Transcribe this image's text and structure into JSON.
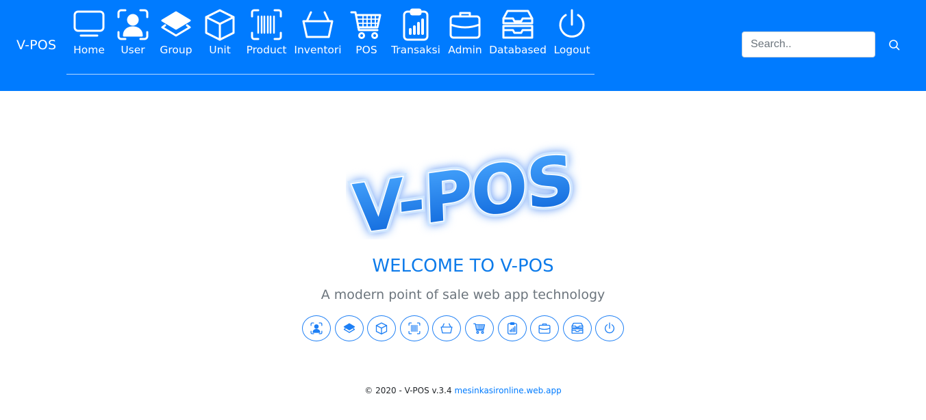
{
  "brand": "V-POS",
  "nav": [
    {
      "label": "Home",
      "icon": "monitor-icon"
    },
    {
      "label": "User",
      "icon": "user-icon"
    },
    {
      "label": "Group",
      "icon": "layers-icon"
    },
    {
      "label": "Unit",
      "icon": "box-icon"
    },
    {
      "label": "Product",
      "icon": "barcode-icon"
    },
    {
      "label": "Inventori",
      "icon": "basket-icon"
    },
    {
      "label": "POS",
      "icon": "cart-icon"
    },
    {
      "label": "Transaksi",
      "icon": "clipboard-chart-icon"
    },
    {
      "label": "Admin",
      "icon": "briefcase-icon"
    },
    {
      "label": "Databased",
      "icon": "inbox-stack-icon"
    },
    {
      "label": "Logout",
      "icon": "power-icon"
    }
  ],
  "search": {
    "placeholder": "Search..",
    "value": ""
  },
  "logo_text": "V-POS",
  "welcome": "WELCOME TO V-POS",
  "tagline": "A modern point of sale web app technology",
  "shortcuts": [
    "user-icon",
    "layers-icon",
    "box-icon",
    "barcode-icon",
    "basket-icon",
    "cart-icon",
    "clipboard-chart-icon",
    "briefcase-icon",
    "inbox-stack-icon",
    "power-icon"
  ],
  "footer": {
    "text": "© 2020 - V-POS v.3.4",
    "link": "mesinkasironline.web.app"
  },
  "colors": {
    "primary": "#007bff",
    "welcome": "#0d7bea",
    "muted": "#6c757d"
  }
}
